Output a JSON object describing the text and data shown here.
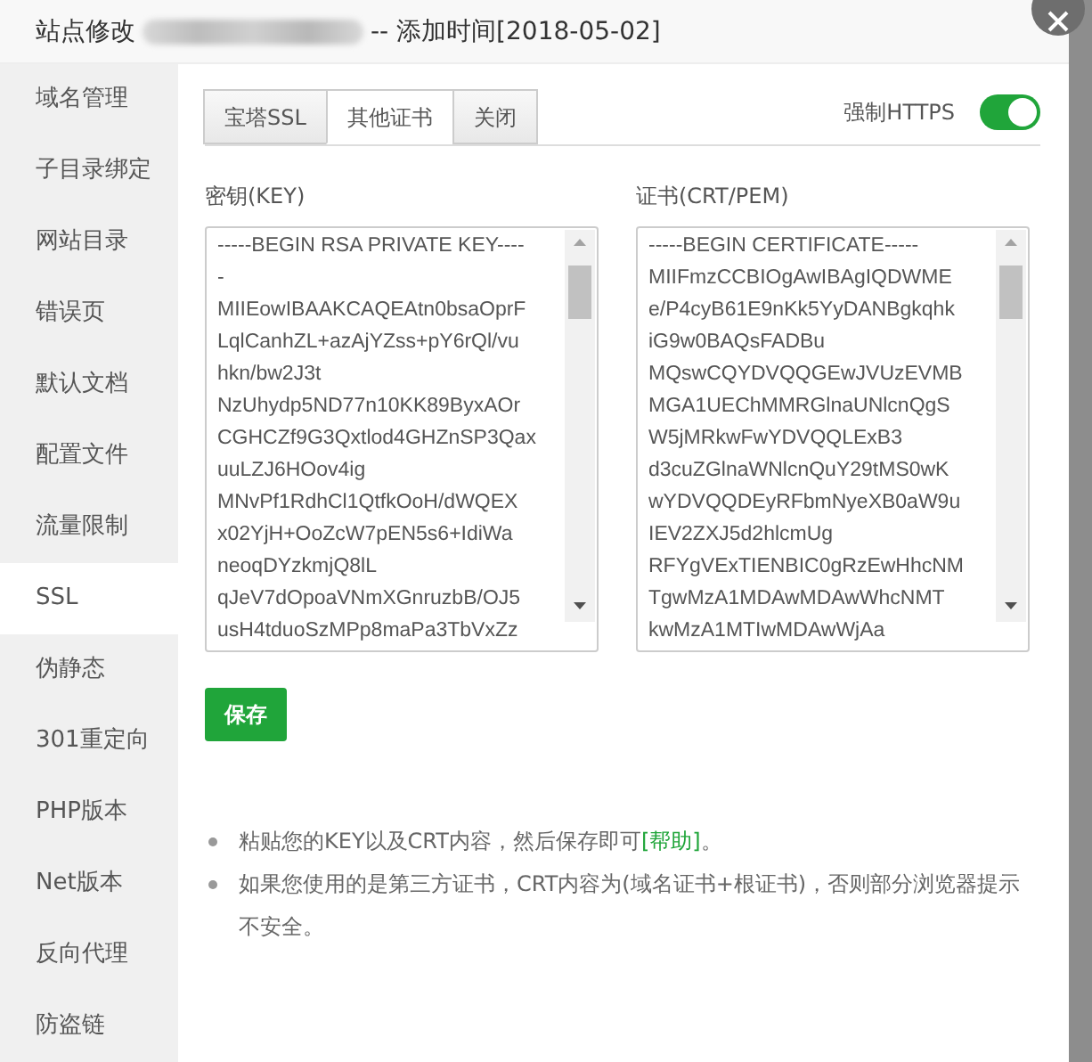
{
  "window": {
    "title_prefix": "站点修改",
    "title_suffix": "-- 添加时间[2018-05-02]"
  },
  "sidebar": {
    "items": [
      {
        "label": "域名管理",
        "selected": false
      },
      {
        "label": "子目录绑定",
        "selected": false
      },
      {
        "label": "网站目录",
        "selected": false
      },
      {
        "label": "错误页",
        "selected": false
      },
      {
        "label": "默认文档",
        "selected": false
      },
      {
        "label": "配置文件",
        "selected": false
      },
      {
        "label": "流量限制",
        "selected": false
      },
      {
        "label": "SSL",
        "selected": true
      },
      {
        "label": "伪静态",
        "selected": false
      },
      {
        "label": "301重定向",
        "selected": false
      },
      {
        "label": "PHP版本",
        "selected": false
      },
      {
        "label": "Net版本",
        "selected": false
      },
      {
        "label": "反向代理",
        "selected": false
      },
      {
        "label": "防盗链",
        "selected": false
      }
    ]
  },
  "tabs": [
    {
      "label": "宝塔SSL",
      "selected": false
    },
    {
      "label": "其他证书",
      "selected": true
    },
    {
      "label": "关闭",
      "selected": false
    }
  ],
  "force_https": {
    "label": "强制HTTPS",
    "on": true
  },
  "key": {
    "label": "密钥(KEY)",
    "value": [
      "-----BEGIN RSA PRIVATE KEY----",
      "-",
      "MIIEowIBAAKCAQEAtn0bsaOprF",
      "LqlCanhZL+azAjYZss+pY6rQl/vu",
      "hkn/bw2J3t",
      "NzUhydp5ND77n10KK89ByxAOr",
      "CGHCZf9G3Qxtlod4GHZnSP3Qax",
      "uuLZJ6HOov4ig",
      "MNvPf1RdhCl1QtfkOoH/dWQEX",
      "x02YjH+OoZcW7pEN5s6+IdiWa",
      "neoqDYzkmjQ8lL",
      "qJeV7dOpoaVNmXGnruzbB/OJ5",
      "usH4tduoSzMPp8maPa3TbVxZz"
    ]
  },
  "cert": {
    "label": "证书(CRT/PEM)",
    "value": [
      "-----BEGIN CERTIFICATE-----",
      "MIIFmzCCBIOgAwIBAgIQDWME",
      "e/P4cyB61E9nKk5YyDANBgkqhk",
      "iG9w0BAQsFADBu",
      "MQswCQYDVQQGEwJVUzEVMB",
      "MGA1UEChMMRGlnaUNlcnQgS",
      "W5jMRkwFwYDVQQLExB3",
      "d3cuZGlnaWNlcnQuY29tMS0wK",
      "wYDVQQDEyRFbmNyeXB0aW9u",
      "IEV2ZXJ5d2hlcmUg",
      "RFYgVExTIENBIC0gRzEwHhcNM",
      "TgwMzA1MDAwMDAwWhcNMT",
      "kwMzA1MTIwMDAwWjAa"
    ]
  },
  "save_button": "保存",
  "notes": [
    {
      "text": "粘贴您的KEY以及CRT内容，然后保存即可",
      "link": "[帮助]",
      "after": "。"
    },
    {
      "text": "如果您使用的是第三方证书，CRT内容为(域名证书+根证书)，否则部分浏览器提示不安全。"
    }
  ]
}
